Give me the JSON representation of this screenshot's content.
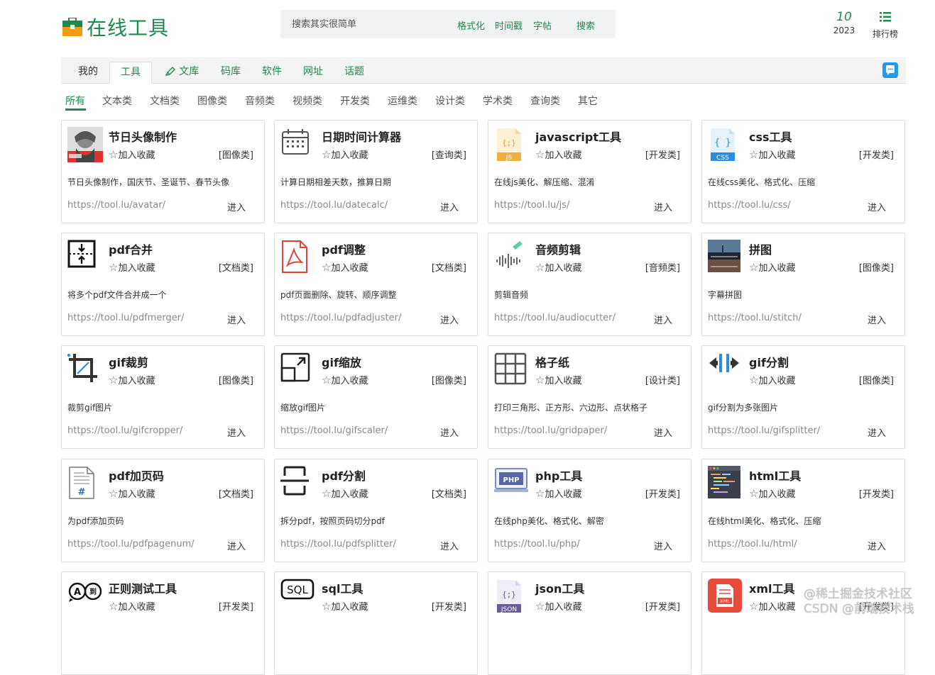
{
  "header": {
    "logo_text": "在线工具",
    "search": {
      "placeholder": "搜索其实很简单",
      "quick_links": [
        "格式化",
        "时间戳",
        "字帖"
      ],
      "button_label": "搜索"
    },
    "day": "10",
    "year": "2023",
    "rank_label": "排行榜"
  },
  "nav": {
    "tabs": [
      {
        "label": "我的",
        "active": false
      },
      {
        "label": "工具",
        "active": true
      },
      {
        "label": "文库",
        "active": false
      },
      {
        "label": "码库",
        "active": false
      },
      {
        "label": "软件",
        "active": false
      },
      {
        "label": "网址",
        "active": false
      },
      {
        "label": "话题",
        "active": false
      }
    ]
  },
  "categories": [
    "所有",
    "文本类",
    "文档类",
    "图像类",
    "音频类",
    "视频类",
    "开发类",
    "运维类",
    "设计类",
    "学术类",
    "查询类",
    "其它"
  ],
  "active_category": "所有",
  "fav_label": "加入收藏",
  "enter_label": "进入",
  "tools": [
    {
      "title": "节日头像制作",
      "category": "[图像类]",
      "desc": "节日头像制作，国庆节、圣诞节、春节头像",
      "url": "https://tool.lu/avatar/",
      "icon": "avatar-icon"
    },
    {
      "title": "日期时间计算器",
      "category": "[查询类]",
      "desc": "计算日期相差天数，推算日期",
      "url": "https://tool.lu/datecalc/",
      "icon": "calendar-icon"
    },
    {
      "title": "javascript工具",
      "category": "[开发类]",
      "desc": "在线js美化、解压缩、混淆",
      "url": "https://tool.lu/js/",
      "icon": "js-file-icon"
    },
    {
      "title": "css工具",
      "category": "[开发类]",
      "desc": "在线css美化、格式化、压缩",
      "url": "https://tool.lu/css/",
      "icon": "css-file-icon"
    },
    {
      "title": "pdf合并",
      "category": "[文档类]",
      "desc": "将多个pdf文件合并成一个",
      "url": "https://tool.lu/pdfmerger/",
      "icon": "merge-icon"
    },
    {
      "title": "pdf调整",
      "category": "[文档类]",
      "desc": "pdf页面删除、旋转、顺序调整",
      "url": "https://tool.lu/pdfadjuster/",
      "icon": "pdf-icon"
    },
    {
      "title": "音频剪辑",
      "category": "[音频类]",
      "desc": "剪辑音频",
      "url": "https://tool.lu/audiocutter/",
      "icon": "waveform-icon"
    },
    {
      "title": "拼图",
      "category": "[图像类]",
      "desc": "字幕拼图",
      "url": "https://tool.lu/stitch/",
      "icon": "stitch-photo-icon"
    },
    {
      "title": "gif裁剪",
      "category": "[图像类]",
      "desc": "裁剪gif图片",
      "url": "https://tool.lu/gifcropper/",
      "icon": "crop-icon"
    },
    {
      "title": "gif缩放",
      "category": "[图像类]",
      "desc": "缩放gif图片",
      "url": "https://tool.lu/gifscaler/",
      "icon": "resize-icon"
    },
    {
      "title": "格子纸",
      "category": "[设计类]",
      "desc": "打印三角形、正方形、六边形、点状格子",
      "url": "https://tool.lu/gridpaper/",
      "icon": "grid-icon"
    },
    {
      "title": "gif分割",
      "category": "[图像类]",
      "desc": "gif分割为多张图片",
      "url": "https://tool.lu/gifsplitter/",
      "icon": "split-icon"
    },
    {
      "title": "pdf加页码",
      "category": "[文档类]",
      "desc": "为pdf添加页码",
      "url": "https://tool.lu/pdfpagenum/",
      "icon": "page-number-icon"
    },
    {
      "title": "pdf分割",
      "category": "[文档类]",
      "desc": "拆分pdf，按照页码切分pdf",
      "url": "https://tool.lu/pdfsplitter/",
      "icon": "pdf-split-icon"
    },
    {
      "title": "php工具",
      "category": "[开发类]",
      "desc": "在线php美化、格式化、解密",
      "url": "https://tool.lu/php/",
      "icon": "php-icon"
    },
    {
      "title": "html工具",
      "category": "[开发类]",
      "desc": "在线html美化、格式化、压缩",
      "url": "https://tool.lu/html/",
      "icon": "html-code-icon"
    },
    {
      "title": "正则测试工具",
      "category": "[开发类]",
      "desc": "",
      "url": "",
      "icon": "regex-icon"
    },
    {
      "title": "sql工具",
      "category": "[开发类]",
      "desc": "",
      "url": "",
      "icon": "sql-icon"
    },
    {
      "title": "json工具",
      "category": "[开发类]",
      "desc": "",
      "url": "",
      "icon": "json-file-icon"
    },
    {
      "title": "xml工具",
      "category": "[开发类]",
      "desc": "",
      "url": "",
      "icon": "xml-file-icon"
    }
  ],
  "watermark": {
    "line1": "@稀土掘金技术社区",
    "line2": "CSDN @前端技术栈"
  },
  "colors": {
    "brand": "#1e8a4c",
    "chat": "#1e9bf0",
    "tab_bg": "#f3f3f3"
  }
}
